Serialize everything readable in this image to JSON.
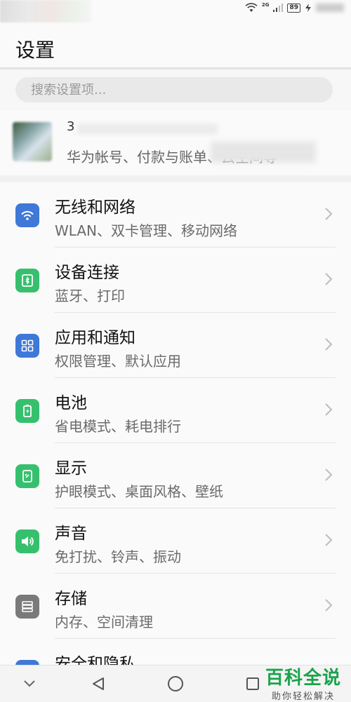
{
  "status_bar": {
    "network": "2G",
    "battery": "89"
  },
  "header": {
    "title": "设置"
  },
  "search": {
    "placeholder": "搜索设置项..."
  },
  "account": {
    "name": "3",
    "subtitle": "华为帐号、付款与账单、云空间等"
  },
  "settings": [
    {
      "title": "无线和网络",
      "subtitle": "WLAN、双卡管理、移动网络",
      "icon": "wifi-icon",
      "color": "#3f78d8"
    },
    {
      "title": "设备连接",
      "subtitle": "蓝牙、打印",
      "icon": "device-connection-icon",
      "color": "#36c06e"
    },
    {
      "title": "应用和通知",
      "subtitle": "权限管理、默认应用",
      "icon": "apps-grid-icon",
      "color": "#3f78d8"
    },
    {
      "title": "电池",
      "subtitle": "省电模式、耗电排行",
      "icon": "battery-icon",
      "color": "#36c06e"
    },
    {
      "title": "显示",
      "subtitle": "护眼模式、桌面风格、壁纸",
      "icon": "display-icon",
      "color": "#36c06e"
    },
    {
      "title": "声音",
      "subtitle": "免打扰、铃声、振动",
      "icon": "speaker-icon",
      "color": "#36c06e"
    },
    {
      "title": "存储",
      "subtitle": "内存、空间清理",
      "icon": "storage-icon",
      "color": "#7a7a7a"
    },
    {
      "title": "安全和隐私",
      "subtitle": "",
      "icon": "shield-icon",
      "color": "#3f78d8"
    }
  ],
  "watermark": {
    "title": "百科全说",
    "subtitle": "助你轻松解决"
  }
}
